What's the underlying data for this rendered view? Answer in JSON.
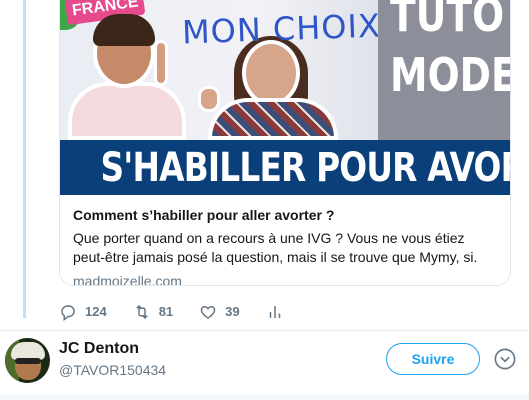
{
  "card": {
    "image": {
      "badge_text": "FRANCE",
      "handwritten_text": "MON CHOIX",
      "tuto_line1": "TUTO",
      "tuto_line2": "MODE",
      "banner_text": "S'HABILLER POUR AVORTER"
    },
    "title": "Comment s’habiller pour aller avorter ?",
    "description": "Que porter quand on a recours à une IVG ? Vous ne vous étiez peut-être jamais posé la question, mais il se trouve que Mymy, si.",
    "domain": "madmoizelle.com"
  },
  "actions": {
    "reply": {
      "icon": "reply-icon",
      "count": "124"
    },
    "retweet": {
      "icon": "retweet-icon",
      "count": "81"
    },
    "like": {
      "icon": "heart-icon",
      "count": "39"
    },
    "analytics": {
      "icon": "analytics-icon"
    }
  },
  "user": {
    "name": "JC Denton",
    "handle": "@TAVOR150434",
    "follow_label": "Suivre"
  },
  "colors": {
    "accent": "#1da1f2",
    "secondary_text": "#657786",
    "thread_line": "#bfe1f6"
  }
}
